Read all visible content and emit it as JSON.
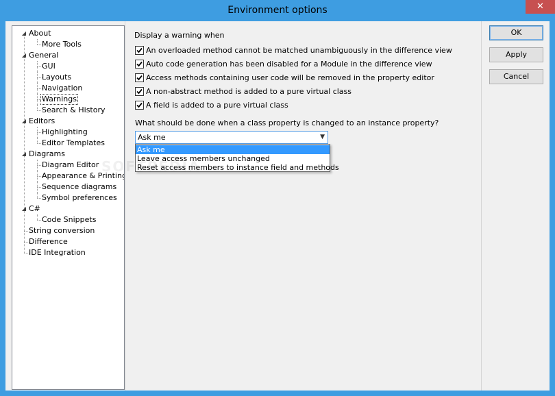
{
  "window": {
    "title": "Environment options",
    "close_symbol": "✕"
  },
  "tree": {
    "items": [
      {
        "label": "About",
        "level": 0,
        "expanded": true
      },
      {
        "label": "More Tools",
        "level": 1
      },
      {
        "label": "General",
        "level": 0,
        "expanded": true
      },
      {
        "label": "GUI",
        "level": 1
      },
      {
        "label": "Layouts",
        "level": 1
      },
      {
        "label": "Navigation",
        "level": 1
      },
      {
        "label": "Warnings",
        "level": 1,
        "selected": true
      },
      {
        "label": "Search & History",
        "level": 1
      },
      {
        "label": "Editors",
        "level": 0,
        "expanded": true
      },
      {
        "label": "Highlighting",
        "level": 1
      },
      {
        "label": "Editor Templates",
        "level": 1
      },
      {
        "label": "Diagrams",
        "level": 0,
        "expanded": true
      },
      {
        "label": "Diagram Editor",
        "level": 1
      },
      {
        "label": "Appearance & Printing",
        "level": 1
      },
      {
        "label": "Sequence diagrams",
        "level": 1
      },
      {
        "label": "Symbol preferences",
        "level": 1
      },
      {
        "label": "C#",
        "level": 0,
        "expanded": true
      },
      {
        "label": "Code Snippets",
        "level": 1
      },
      {
        "label": "String conversion",
        "level": 0
      },
      {
        "label": "Difference",
        "level": 0
      },
      {
        "label": "IDE Integration",
        "level": 0
      }
    ]
  },
  "warnings": {
    "heading": "Display a warning when",
    "checks": [
      {
        "label": "An overloaded method cannot be matched unambiguously in the difference view",
        "checked": true
      },
      {
        "label": "Auto code generation has been disabled for a Module in the difference view",
        "checked": true
      },
      {
        "label": "Access methods containing user code will be removed in the property editor",
        "checked": true
      },
      {
        "label": "A non-abstract method is added to a pure virtual class",
        "checked": true
      },
      {
        "label": "A field is added to a pure virtual class",
        "checked": true
      }
    ],
    "question": "What should be done when a class property  is changed to an instance property?",
    "combo_value": "Ask me",
    "options": [
      "Ask me",
      "Leave access members unchanged",
      "Reset access members to instance field and methods"
    ]
  },
  "buttons": {
    "ok": "OK",
    "apply": "Apply",
    "cancel": "Cancel"
  },
  "watermark": "SOFTPEDIA",
  "colors": {
    "titlebar": "#3e9de1",
    "close": "#c75050",
    "selection": "#3399ff"
  }
}
